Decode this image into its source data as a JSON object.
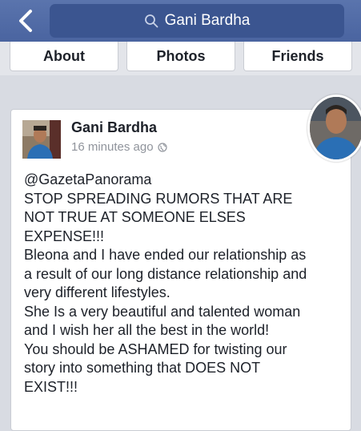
{
  "header": {
    "search_query": "Gani Bardha"
  },
  "tabs": [
    {
      "label": "About"
    },
    {
      "label": "Photos"
    },
    {
      "label": "Friends"
    }
  ],
  "post": {
    "author": "Gani Bardha",
    "time": "16 minutes ago",
    "lines": [
      "@GazetaPanorama",
      "STOP SPREADING RUMORS  THAT ARE",
      "NOT TRUE AT SOMEONE ELSES",
      "EXPENSE!!!",
      "Bleona and I have ended our relationship as",
      "a result of our long distance relationship and",
      "very different lifestyles.",
      "She Is a very beautiful and talented woman",
      "and I wish her all the best in the world!",
      "You should be ASHAMED for twisting our",
      "story into something that DOES NOT",
      "EXIST!!!"
    ]
  },
  "colors": {
    "header_bg": "#4a64a0",
    "search_bg": "#3b5590",
    "page_bg": "#d8dbe2"
  }
}
